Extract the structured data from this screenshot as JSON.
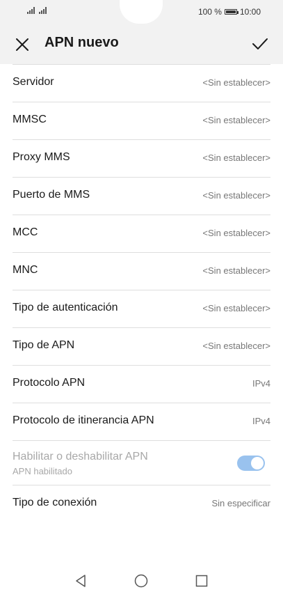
{
  "status_bar": {
    "battery_text": "100 %",
    "time": "10:00",
    "signal_icons": [
      "signal-icon",
      "signal-icon"
    ]
  },
  "app_bar": {
    "title": "APN nuevo",
    "close_icon": "close-icon",
    "confirm_icon": "check-icon"
  },
  "settings": [
    {
      "label": "Servidor",
      "value": "<Sin establecer>"
    },
    {
      "label": "MMSC",
      "value": "<Sin establecer>"
    },
    {
      "label": "Proxy MMS",
      "value": "<Sin establecer>"
    },
    {
      "label": "Puerto de MMS",
      "value": "<Sin establecer>"
    },
    {
      "label": "MCC",
      "value": "<Sin establecer>"
    },
    {
      "label": "MNC",
      "value": "<Sin establecer>"
    },
    {
      "label": "Tipo de autenticación",
      "value": "<Sin establecer>"
    },
    {
      "label": "Tipo de APN",
      "value": "<Sin establecer>"
    },
    {
      "label": "Protocolo APN",
      "value": "IPv4"
    },
    {
      "label": "Protocolo de itinerancia APN",
      "value": "IPv4"
    }
  ],
  "apn_toggle": {
    "label": "Habilitar o deshabilitar APN",
    "sublabel": "APN habilitado",
    "enabled": true
  },
  "connection_type": {
    "label": "Tipo de conexión",
    "value": "Sin especificar"
  },
  "colors": {
    "accent": "#99c2ee",
    "header_bg": "#f2f2f2"
  },
  "nav_icons": [
    "back-icon",
    "home-icon",
    "recents-icon"
  ]
}
